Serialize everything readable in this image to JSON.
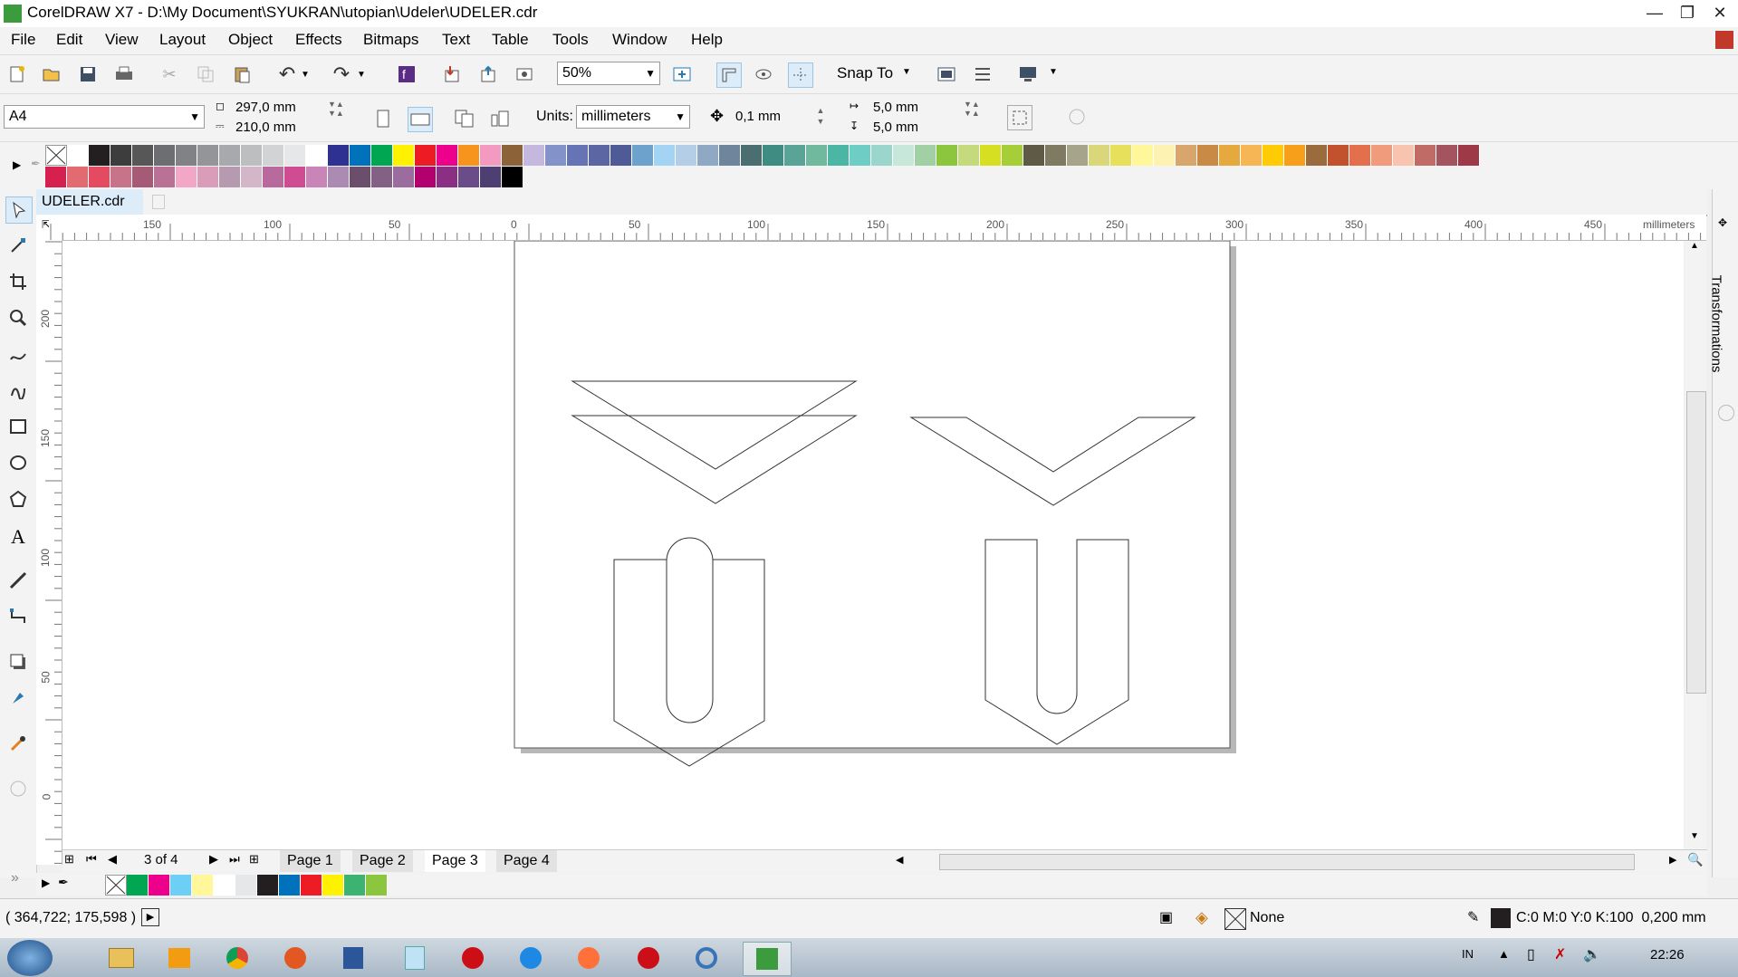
{
  "window": {
    "title": "CorelDRAW X7 - D:\\My Document\\SYUKRAN\\utopian\\Udeler\\UDELER.cdr",
    "controls": [
      "minimize-icon",
      "restore-icon",
      "close-icon"
    ]
  },
  "menu": [
    "File",
    "Edit",
    "View",
    "Layout",
    "Object",
    "Effects",
    "Bitmaps",
    "Text",
    "Table",
    "Tools",
    "Window",
    "Help"
  ],
  "toolbar": {
    "zoom": "50%",
    "snap_to": "Snap To"
  },
  "propbar": {
    "page_size": "A4",
    "width": "297,0 mm",
    "height": "210,0 mm",
    "units_label": "Units:",
    "units": "millimeters",
    "nudge": "0,1 mm",
    "dup_x": "5,0 mm",
    "dup_y": "5,0 mm"
  },
  "palette_colors": [
    "#ffffff",
    "#231f20",
    "#3d3d3d",
    "#575757",
    "#6d6e71",
    "#808285",
    "#939598",
    "#a7a9ac",
    "#bcbec0",
    "#d1d3d4",
    "#e6e7e8",
    "#ffffff",
    "#2e3192",
    "#0072bc",
    "#00a651",
    "#fff200",
    "#ed1c24",
    "#ec008c",
    "#f7941d",
    "#f49ac1",
    "#8c6239",
    "#c4b8de",
    "#8393ca",
    "#6673b5",
    "#5c66a3",
    "#4f5b96",
    "#6da2cc",
    "#a4d4f4",
    "#b3cee6",
    "#8fa8c4",
    "#6e859c",
    "#4b6e71",
    "#3e8c82",
    "#5aa497",
    "#71b99e",
    "#4ab6a3",
    "#6ecdc4",
    "#9ad6cc",
    "#c6e7d9",
    "#a0d0a3",
    "#8cc63f",
    "#c4da7c",
    "#d7df23",
    "#a6ce39",
    "#5e5a45",
    "#7f7b62",
    "#a6a48b",
    "#d9d77a",
    "#e6e05a",
    "#fff799",
    "#fdf2b1",
    "#d8a66d",
    "#c98a45",
    "#e6a93d",
    "#f7b655",
    "#ffcb05",
    "#f79e1b",
    "#9a6b3c",
    "#c2512e",
    "#e36f4d",
    "#f19b7d",
    "#f8c4b0",
    "#c16b66",
    "#a4545e",
    "#9e3a48"
  ],
  "palette_row2": [
    "#d6204f",
    "#e26b72",
    "#e44b60",
    "#c7738a",
    "#a55a75",
    "#b97295",
    "#f3a7c6",
    "#d99cb9",
    "#b69ab0",
    "#d4b6c9",
    "#b96a9c",
    "#cf4c93",
    "#c984b8",
    "#ab8bb3",
    "#6b4d6c",
    "#836185",
    "#9b6d9e",
    "#b3006f",
    "#8a2f84",
    "#6a4c88",
    "#4e3f73",
    "#000000"
  ],
  "document_tab": "UDELER.cdr",
  "ruler_h_labels": [
    "150",
    "100",
    "50",
    "0",
    "50",
    "100",
    "150",
    "200",
    "250",
    "300",
    "350",
    "400",
    "450"
  ],
  "ruler_unit": "millimeters",
  "ruler_v_labels": [
    "200",
    "150",
    "100",
    "50",
    "0"
  ],
  "page_nav": {
    "position": "3 of 4",
    "pages": [
      "Page 1",
      "Page 2",
      "Page 3",
      "Page 4"
    ],
    "active_index": 2
  },
  "doc_palette": [
    "#00a651",
    "#ec008c",
    "#6dcff6",
    "#fff799",
    "#ffffff",
    "#e6e7e8",
    "#231f20",
    "#0072bc",
    "#ed1c24",
    "#fff200",
    "#3cb371",
    "#8cc63f"
  ],
  "status": {
    "coords": "( 364,722; 175,598 )",
    "fill": "None",
    "outline": "C:0 M:0 Y:0 K:100  0,200 mm"
  },
  "docker_label": "Transformations",
  "taskbar": {
    "lang": "IN",
    "time": "22:26"
  }
}
